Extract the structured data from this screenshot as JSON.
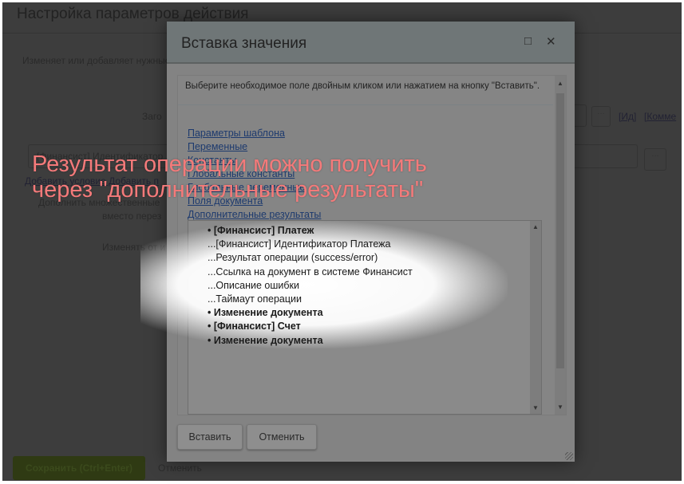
{
  "background": {
    "title": "Настройка параметров действия",
    "description": "Изменяет или добавляет нужные",
    "label_title": "Заго",
    "id_link": "[Ид]",
    "comment_link": "[Комме",
    "field_value": "[Финансист] Идентификатор",
    "add_links": "Добавить условие Добавить п",
    "merge_label": "Дополнить множественные",
    "merge_label2": "вместо перез",
    "change_from": "Изменять от и",
    "dots": "...",
    "save_button": "Сохранить (Ctrl+Enter)",
    "cancel_button": "Отменить"
  },
  "dialog": {
    "title": "Вставка значения",
    "hint": "Выберите необходимое поле двойным кликом или нажатием на кнопку \"Вставить\".",
    "links": [
      "Параметры шаблона",
      "Переменные",
      "Константы",
      "Глобальные константы",
      "Глобальные переменные",
      "Поля документа",
      "Дополнительные результаты"
    ],
    "items": [
      {
        "text": "• [Финансист] Платеж",
        "bold": true
      },
      {
        "text": "...[Финансист] Идентификатор Платежа",
        "bold": false
      },
      {
        "text": "...Результат операции (success/error)",
        "bold": false
      },
      {
        "text": "...Ссылка на документ в системе Финансист",
        "bold": false
      },
      {
        "text": "...Описание ошибки",
        "bold": false
      },
      {
        "text": "...Таймаут операции",
        "bold": false
      },
      {
        "text": "• Изменение документа",
        "bold": true
      },
      {
        "text": "• [Финансист] Счет",
        "bold": true
      },
      {
        "text": "• Изменение документа",
        "bold": true
      }
    ],
    "insert_button": "Вставить",
    "cancel_button": "Отменить"
  },
  "annotation": {
    "line1": "Результат операции можно получить",
    "line2": "через \"дополнительные результаты\""
  }
}
